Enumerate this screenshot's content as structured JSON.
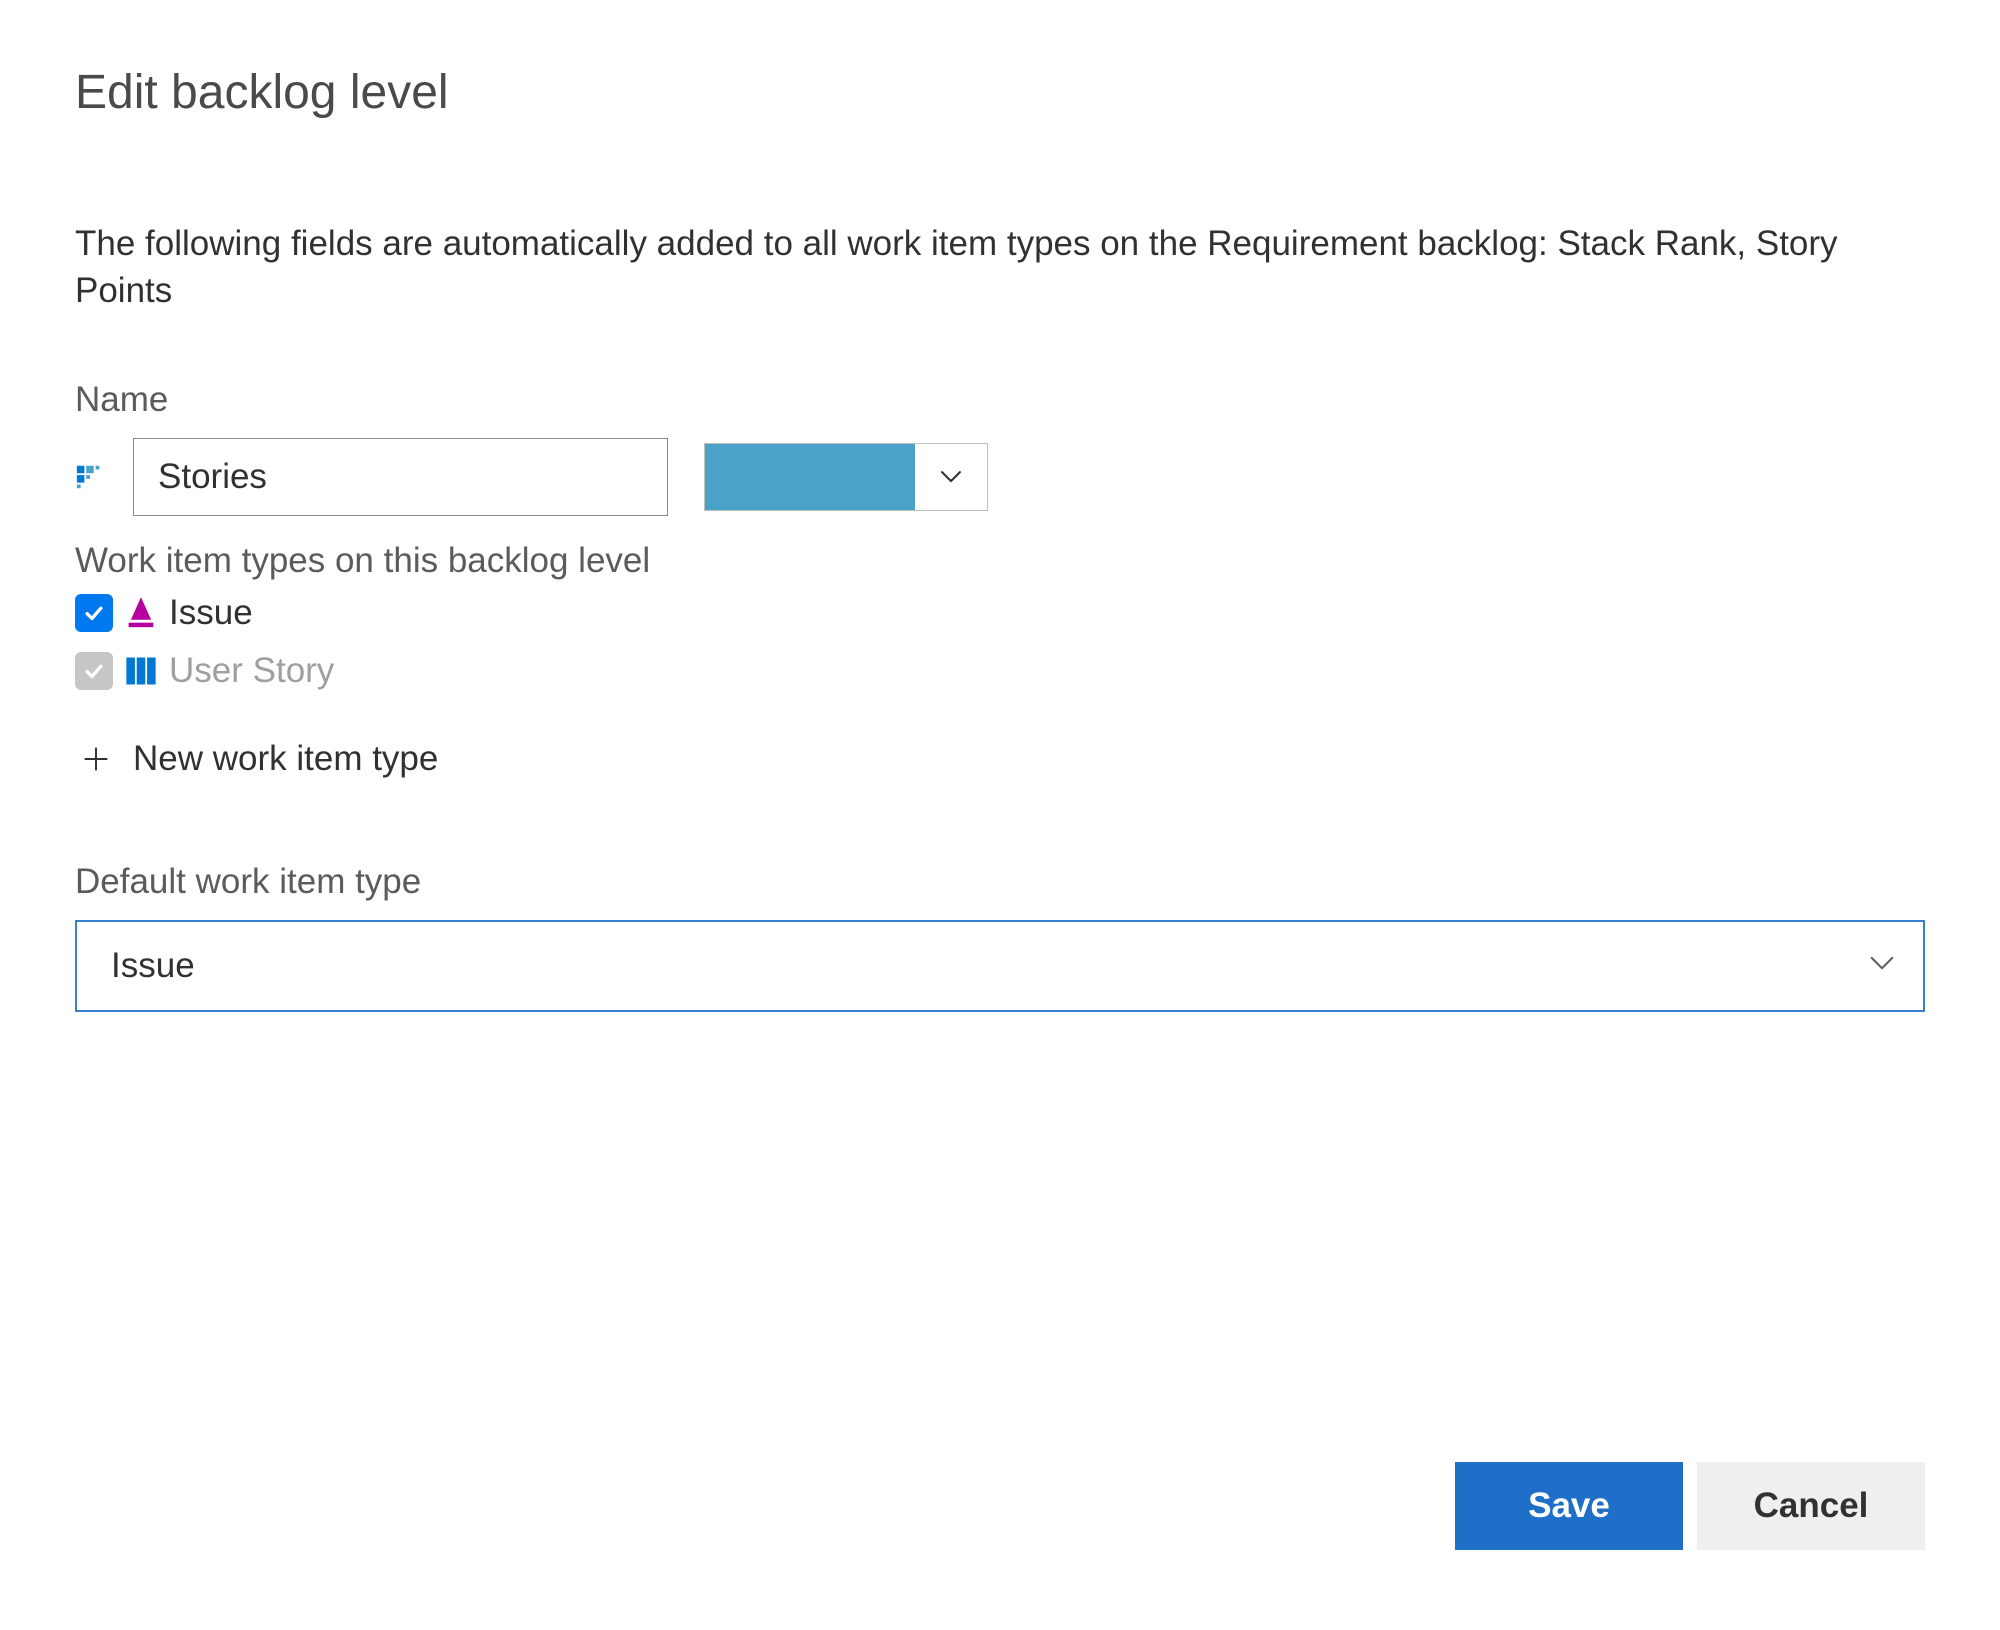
{
  "dialog": {
    "title": "Edit backlog level",
    "description": "The following fields are automatically added to all work item types on the Requirement backlog: Stack Rank, Story Points"
  },
  "name": {
    "label": "Name",
    "value": "Stories",
    "color": "#4ba2c9"
  },
  "workItemTypes": {
    "label": "Work item types on this backlog level",
    "items": [
      {
        "label": "Issue",
        "checked": true,
        "disabled": false,
        "iconColor": "#b4009e"
      },
      {
        "label": "User Story",
        "checked": true,
        "disabled": true,
        "iconColor": "#0078d4"
      }
    ],
    "newLabel": "New work item type"
  },
  "defaultType": {
    "label": "Default work item type",
    "value": "Issue"
  },
  "footer": {
    "save": "Save",
    "cancel": "Cancel"
  }
}
